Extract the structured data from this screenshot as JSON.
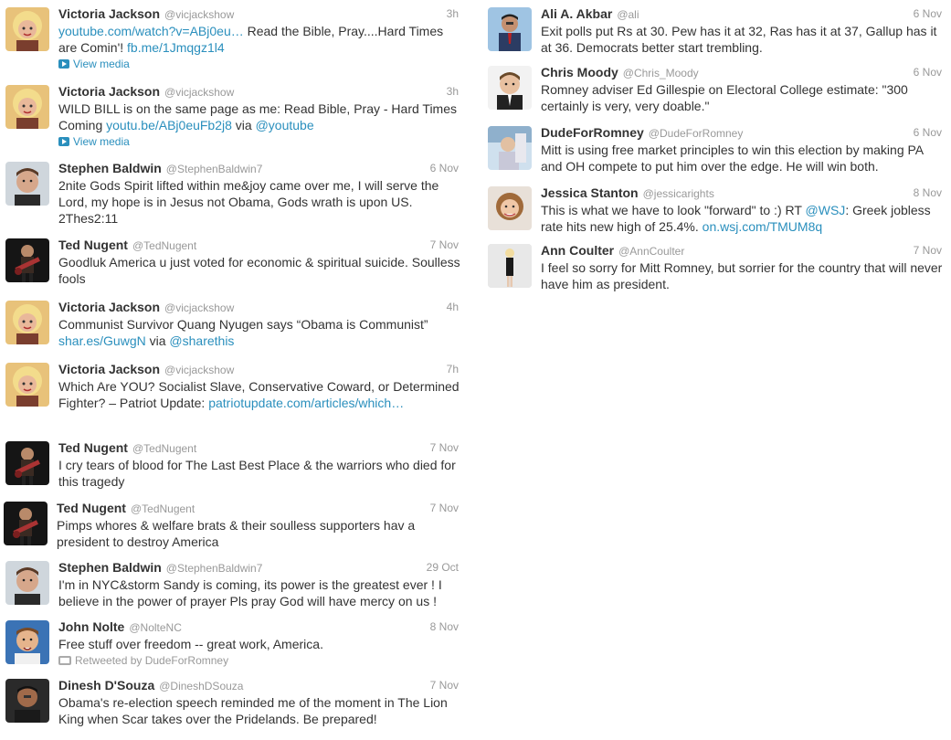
{
  "left_tweets": [
    {
      "name": "Victoria Jackson",
      "handle": "@vicjackshow",
      "time": "3h",
      "avatar": "victoria",
      "text": [
        {
          "t": "youtube.com/watch?v=ABj0eu…",
          "l": true
        },
        {
          "t": " Read the Bible, Pray....Hard Times are Comin'! "
        },
        {
          "t": "fb.me/1Jmqgz1l4",
          "l": true
        }
      ],
      "media": "View media"
    },
    {
      "name": "Victoria Jackson",
      "handle": "@vicjackshow",
      "time": "3h",
      "avatar": "victoria",
      "text": [
        {
          "t": "WILD BILL is on the same page as me: Read Bible, Pray - Hard Times Coming "
        },
        {
          "t": "youtu.be/ABj0euFb2j8",
          "l": true
        },
        {
          "t": " via "
        },
        {
          "t": "@youtube",
          "l": true
        }
      ],
      "media": "View media"
    },
    {
      "name": "Stephen Baldwin",
      "handle": "@StephenBaldwin7",
      "time": "6 Nov",
      "avatar": "stephen",
      "text": [
        {
          "t": "2nite Gods Spirit lifted within me&joy came over me, I will serve the Lord, my hope is in Jesus not Obama, Gods wrath is upon US. 2Thes2:11"
        }
      ]
    },
    {
      "name": "Ted Nugent",
      "handle": "@TedNugent",
      "time": "7 Nov",
      "avatar": "ted",
      "text": [
        {
          "t": "Goodluk America u just voted for economic & spiritual suicide. Soulless fools"
        }
      ]
    },
    {
      "name": "Victoria Jackson",
      "handle": "@vicjackshow",
      "time": "4h",
      "avatar": "victoria",
      "text": [
        {
          "t": "Communist Survivor Quang Nyugen says “Obama is Communist” "
        },
        {
          "t": "shar.es/GuwgN",
          "l": true
        },
        {
          "t": " via "
        },
        {
          "t": "@sharethis",
          "l": true
        }
      ]
    },
    {
      "name": "Victoria Jackson",
      "handle": "@vicjackshow",
      "time": "7h",
      "avatar": "victoria",
      "text": [
        {
          "t": "Which Are YOU? Socialist Slave, Conservative Coward, or Determined Fighter? – Patriot Update: "
        },
        {
          "t": "patriotupdate.com/articles/which…",
          "l": true
        }
      ]
    },
    {
      "name": "Ted Nugent",
      "handle": "@TedNugent",
      "time": "7 Nov",
      "avatar": "ted",
      "text": [
        {
          "t": "I cry tears of blood for The Last Best Place & the warriors who died for this tragedy"
        }
      ]
    },
    {
      "name": "Ted Nugent",
      "handle": "@TedNugent",
      "time": "7 Nov",
      "avatar": "ted",
      "text": [
        {
          "t": "Pimps whores & welfare brats & their soulless supporters hav a president to destroy America"
        }
      ]
    },
    {
      "name": "Stephen Baldwin",
      "handle": "@StephenBaldwin7",
      "time": "29 Oct",
      "avatar": "stephen",
      "text": [
        {
          "t": "I'm in NYC&storm Sandy is coming, its power is the greatest ever ! I believe in the power of prayer Pls pray God will have mercy on us !"
        }
      ]
    },
    {
      "name": "John Nolte",
      "handle": "@NolteNC",
      "time": "8 Nov",
      "avatar": "john",
      "text": [
        {
          "t": "Free stuff over freedom -- great work, America."
        }
      ],
      "retweet": "Retweeted by DudeForRomney"
    },
    {
      "name": "Dinesh D'Souza",
      "handle": "@DineshDSouza",
      "time": "7 Nov",
      "avatar": "dinesh",
      "text": [
        {
          "t": "Obama's re-election speech reminded me of the moment in The Lion King when Scar takes over the Pridelands. Be prepared!"
        }
      ]
    }
  ],
  "right_tweets": [
    {
      "name": "Ali A. Akbar",
      "handle": "@ali",
      "time": "6 Nov",
      "avatar": "ali",
      "text": [
        {
          "t": "Exit polls put Rs at 30. Pew has it at 32, Ras has it at 37, Gallup has it at 36. Democrats better start trembling."
        }
      ]
    },
    {
      "name": "Chris Moody",
      "handle": "@Chris_Moody",
      "time": "6 Nov",
      "avatar": "chris",
      "text": [
        {
          "t": "Romney adviser Ed Gillespie on Electoral College estimate: \"300 certainly is very, very doable.\""
        }
      ]
    },
    {
      "name": "DudeForRomney",
      "handle": "@DudeForRomney",
      "time": "6 Nov",
      "avatar": "dude",
      "text": [
        {
          "t": "Mitt is using free market principles to win this election by making PA and OH compete to put him over the edge. He will win both."
        }
      ]
    },
    {
      "name": "Jessica Stanton",
      "handle": "@jessicarights",
      "time": "8 Nov",
      "avatar": "jessica",
      "text": [
        {
          "t": "This is what we have to look \"forward\" to :) RT "
        },
        {
          "t": "@WSJ",
          "l": true
        },
        {
          "t": ": Greek jobless rate hits new high of 25.4%. "
        },
        {
          "t": "on.wsj.com/TMUM8q",
          "l": true
        }
      ]
    },
    {
      "name": "Ann Coulter",
      "handle": "@AnnCoulter",
      "time": "7 Nov",
      "avatar": "ann",
      "text": [
        {
          "t": "I feel so sorry for Mitt Romney, but sorrier for the country that will never have him as president."
        }
      ]
    }
  ],
  "colors": {
    "link": "#2a8fbd",
    "meta": "#999999",
    "text": "#333333"
  }
}
